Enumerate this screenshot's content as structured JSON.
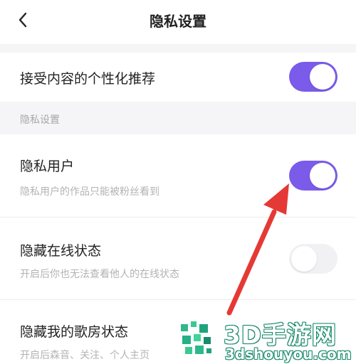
{
  "nav": {
    "title": "隐私设置"
  },
  "rows": {
    "personalized": {
      "title": "接受内容的个性化推荐",
      "toggle": "on"
    },
    "section_label": "隐私设置",
    "private_user": {
      "title": "隐私用户",
      "subtitle": "隐私用户的作品只能被粉丝看到",
      "toggle": "on"
    },
    "hide_online": {
      "title": "隐藏在线状态",
      "subtitle": "开启后你也无法查看他人的在线状态",
      "toggle": "off"
    },
    "hide_room": {
      "title": "隐藏我的歌房状态",
      "subtitle": "开启后森音、关注、个人主页"
    }
  },
  "watermark": {
    "brand": "3D手游网",
    "domain": "3dshouyou.com"
  },
  "colors": {
    "accent": "#7a5bea",
    "annotation_arrow": "#e53935",
    "watermark_green": "#1a8a6a"
  },
  "icons": {
    "back": "chevron-left-icon",
    "annotation": "red-arrow-icon",
    "logo": "3d-shouyou-logo-icon"
  }
}
